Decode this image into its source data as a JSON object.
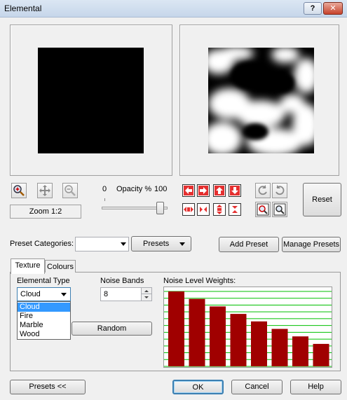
{
  "window": {
    "title": "Elemental",
    "help_label": "?",
    "close_label": "✕"
  },
  "zoom": {
    "label": "Zoom 1:2"
  },
  "opacity": {
    "min_label": "0",
    "label": "Opacity %",
    "max_label": "100",
    "value": 100
  },
  "buttons": {
    "reset": "Reset",
    "presets_combo": "Presets",
    "add_preset": "Add Preset",
    "manage_presets": "Manage Presets",
    "random": "Random",
    "presets_toggle": "Presets   <<",
    "ok": "OK",
    "cancel": "Cancel",
    "help": "Help"
  },
  "preset_categories": {
    "label": "Preset Categories:",
    "value": ""
  },
  "tabs": [
    {
      "label": "Texture"
    },
    {
      "label": "Colours"
    }
  ],
  "texture": {
    "elemental_type_label": "Elemental Type",
    "elemental_type_value": "Cloud",
    "elemental_type_options": [
      "Cloud",
      "Fire",
      "Marble",
      "Wood"
    ],
    "noise_bands_label": "Noise Bands",
    "noise_bands_value": "8",
    "noise_weights_label": "Noise Level Weights:"
  },
  "icons": {
    "zoom_in": "magnifier-plus-icon",
    "pan": "move-icon",
    "zoom_out": "magnifier-minus-icon",
    "rotate_left": "rotate-ccw-icon",
    "rotate_right": "rotate-cw-icon"
  },
  "colors": {
    "bar": "#a00000",
    "gridline": "#00c000",
    "selection": "#3399ff"
  },
  "chart_data": {
    "type": "bar",
    "title": "Noise Level Weights:",
    "values": [
      1.0,
      0.9,
      0.8,
      0.7,
      0.6,
      0.5,
      0.4,
      0.3
    ],
    "ylim": [
      0,
      1
    ],
    "grid": true
  }
}
